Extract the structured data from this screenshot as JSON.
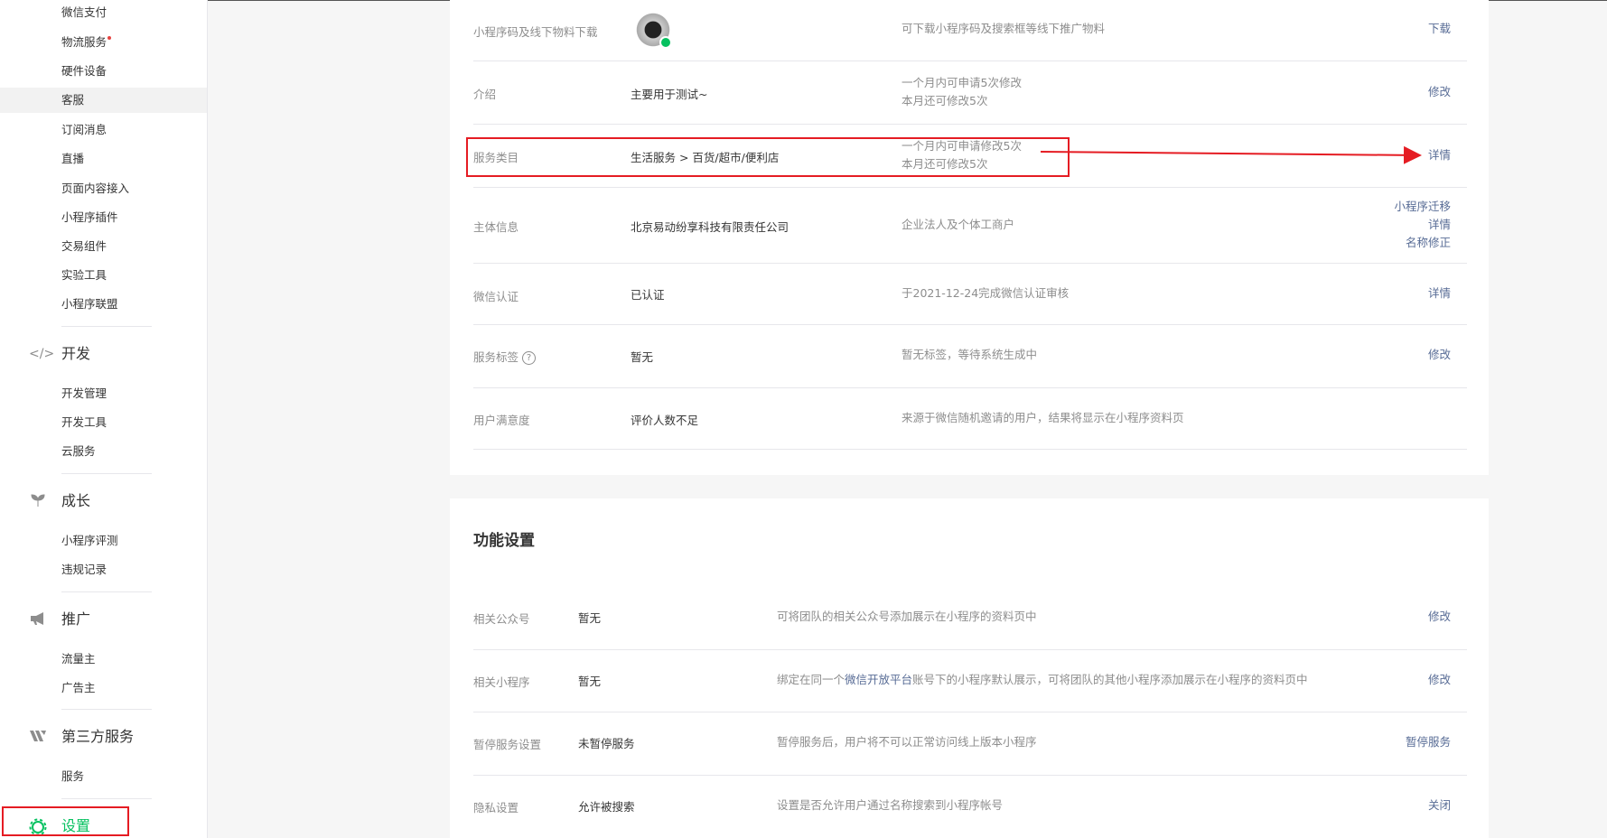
{
  "sidebar": {
    "items_top": [
      {
        "label": "微信支付"
      },
      {
        "label": "物流服务"
      },
      {
        "label": "硬件设备"
      },
      {
        "label": "客服"
      },
      {
        "label": "订阅消息"
      },
      {
        "label": "直播"
      },
      {
        "label": "页面内容接入"
      },
      {
        "label": "小程序插件"
      },
      {
        "label": "交易组件"
      },
      {
        "label": "实验工具"
      },
      {
        "label": "小程序联盟"
      }
    ],
    "groups": {
      "dev": {
        "label": "开发",
        "icon": "code-icon",
        "items": [
          {
            "label": "开发管理"
          },
          {
            "label": "开发工具"
          },
          {
            "label": "云服务"
          }
        ]
      },
      "growth": {
        "label": "成长",
        "icon": "sprout-icon",
        "items": [
          {
            "label": "小程序评测"
          },
          {
            "label": "违规记录"
          }
        ]
      },
      "promo": {
        "label": "推广",
        "icon": "megaphone-icon",
        "items": [
          {
            "label": "流量主"
          },
          {
            "label": "广告主"
          }
        ]
      },
      "third": {
        "label": "第三方服务",
        "icon": "third-party-icon",
        "items": [
          {
            "label": "服务"
          }
        ]
      },
      "settings": {
        "label": "设置",
        "icon": "gear-icon"
      }
    },
    "accent_color": "#07c160"
  },
  "basic_info": {
    "rows": [
      {
        "label": "小程序码及线下物料下载",
        "value": "",
        "desc": [
          "可下载小程序码及搜索框等线下推广物料"
        ],
        "actions": [
          "下载"
        ]
      },
      {
        "label": "介绍",
        "value": "主要用于测试~",
        "desc": [
          "一个月内可申请5次修改",
          "本月还可修改5次"
        ],
        "actions": [
          "修改"
        ]
      },
      {
        "label": "服务类目",
        "value": "生活服务 > 百货/超市/便利店",
        "desc": [
          "一个月内可申请修改5次",
          "本月还可修改5次"
        ],
        "actions": [
          "详情"
        ]
      },
      {
        "label": "主体信息",
        "value": "北京易动纷享科技有限责任公司",
        "desc": [
          "企业法人及个体工商户"
        ],
        "actions": [
          "小程序迁移",
          "详情",
          "名称修正"
        ]
      },
      {
        "label": "微信认证",
        "value": "已认证",
        "desc": [
          "于2021-12-24完成微信认证审核"
        ],
        "actions": [
          "详情"
        ]
      },
      {
        "label": "服务标签",
        "value": "暂无",
        "desc": [
          "暂无标签，等待系统生成中"
        ],
        "actions": [
          "修改"
        ]
      },
      {
        "label": "用户满意度",
        "value": "评价人数不足",
        "desc": [
          "来源于微信随机邀请的用户，结果将显示在小程序资料页"
        ],
        "actions": []
      }
    ],
    "help_glyph": "?"
  },
  "feature_settings": {
    "title": "功能设置",
    "rows": [
      {
        "label": "相关公众号",
        "value": "暂无",
        "desc_pre": "可将团队的相关公众号添加展示在小程序的资料页中",
        "desc_link": "",
        "desc_post": "",
        "action": "修改"
      },
      {
        "label": "相关小程序",
        "value": "暂无",
        "desc_pre": "绑定在同一个",
        "desc_link": "微信开放平台",
        "desc_post": "账号下的小程序默认展示，可将团队的其他小程序添加展示在小程序的资料页中",
        "action": "修改"
      },
      {
        "label": "暂停服务设置",
        "value": "未暂停服务",
        "desc_pre": "暂停服务后，用户将不可以正常访问线上版本小程序",
        "desc_link": "",
        "desc_post": "",
        "action": "暂停服务"
      },
      {
        "label": "隐私设置",
        "value": "允许被搜索",
        "desc_pre": "设置是否允许用户通过名称搜索到小程序帐号",
        "desc_link": "",
        "desc_post": "",
        "action": "关闭"
      }
    ]
  },
  "annotation_color": "#e51c23"
}
